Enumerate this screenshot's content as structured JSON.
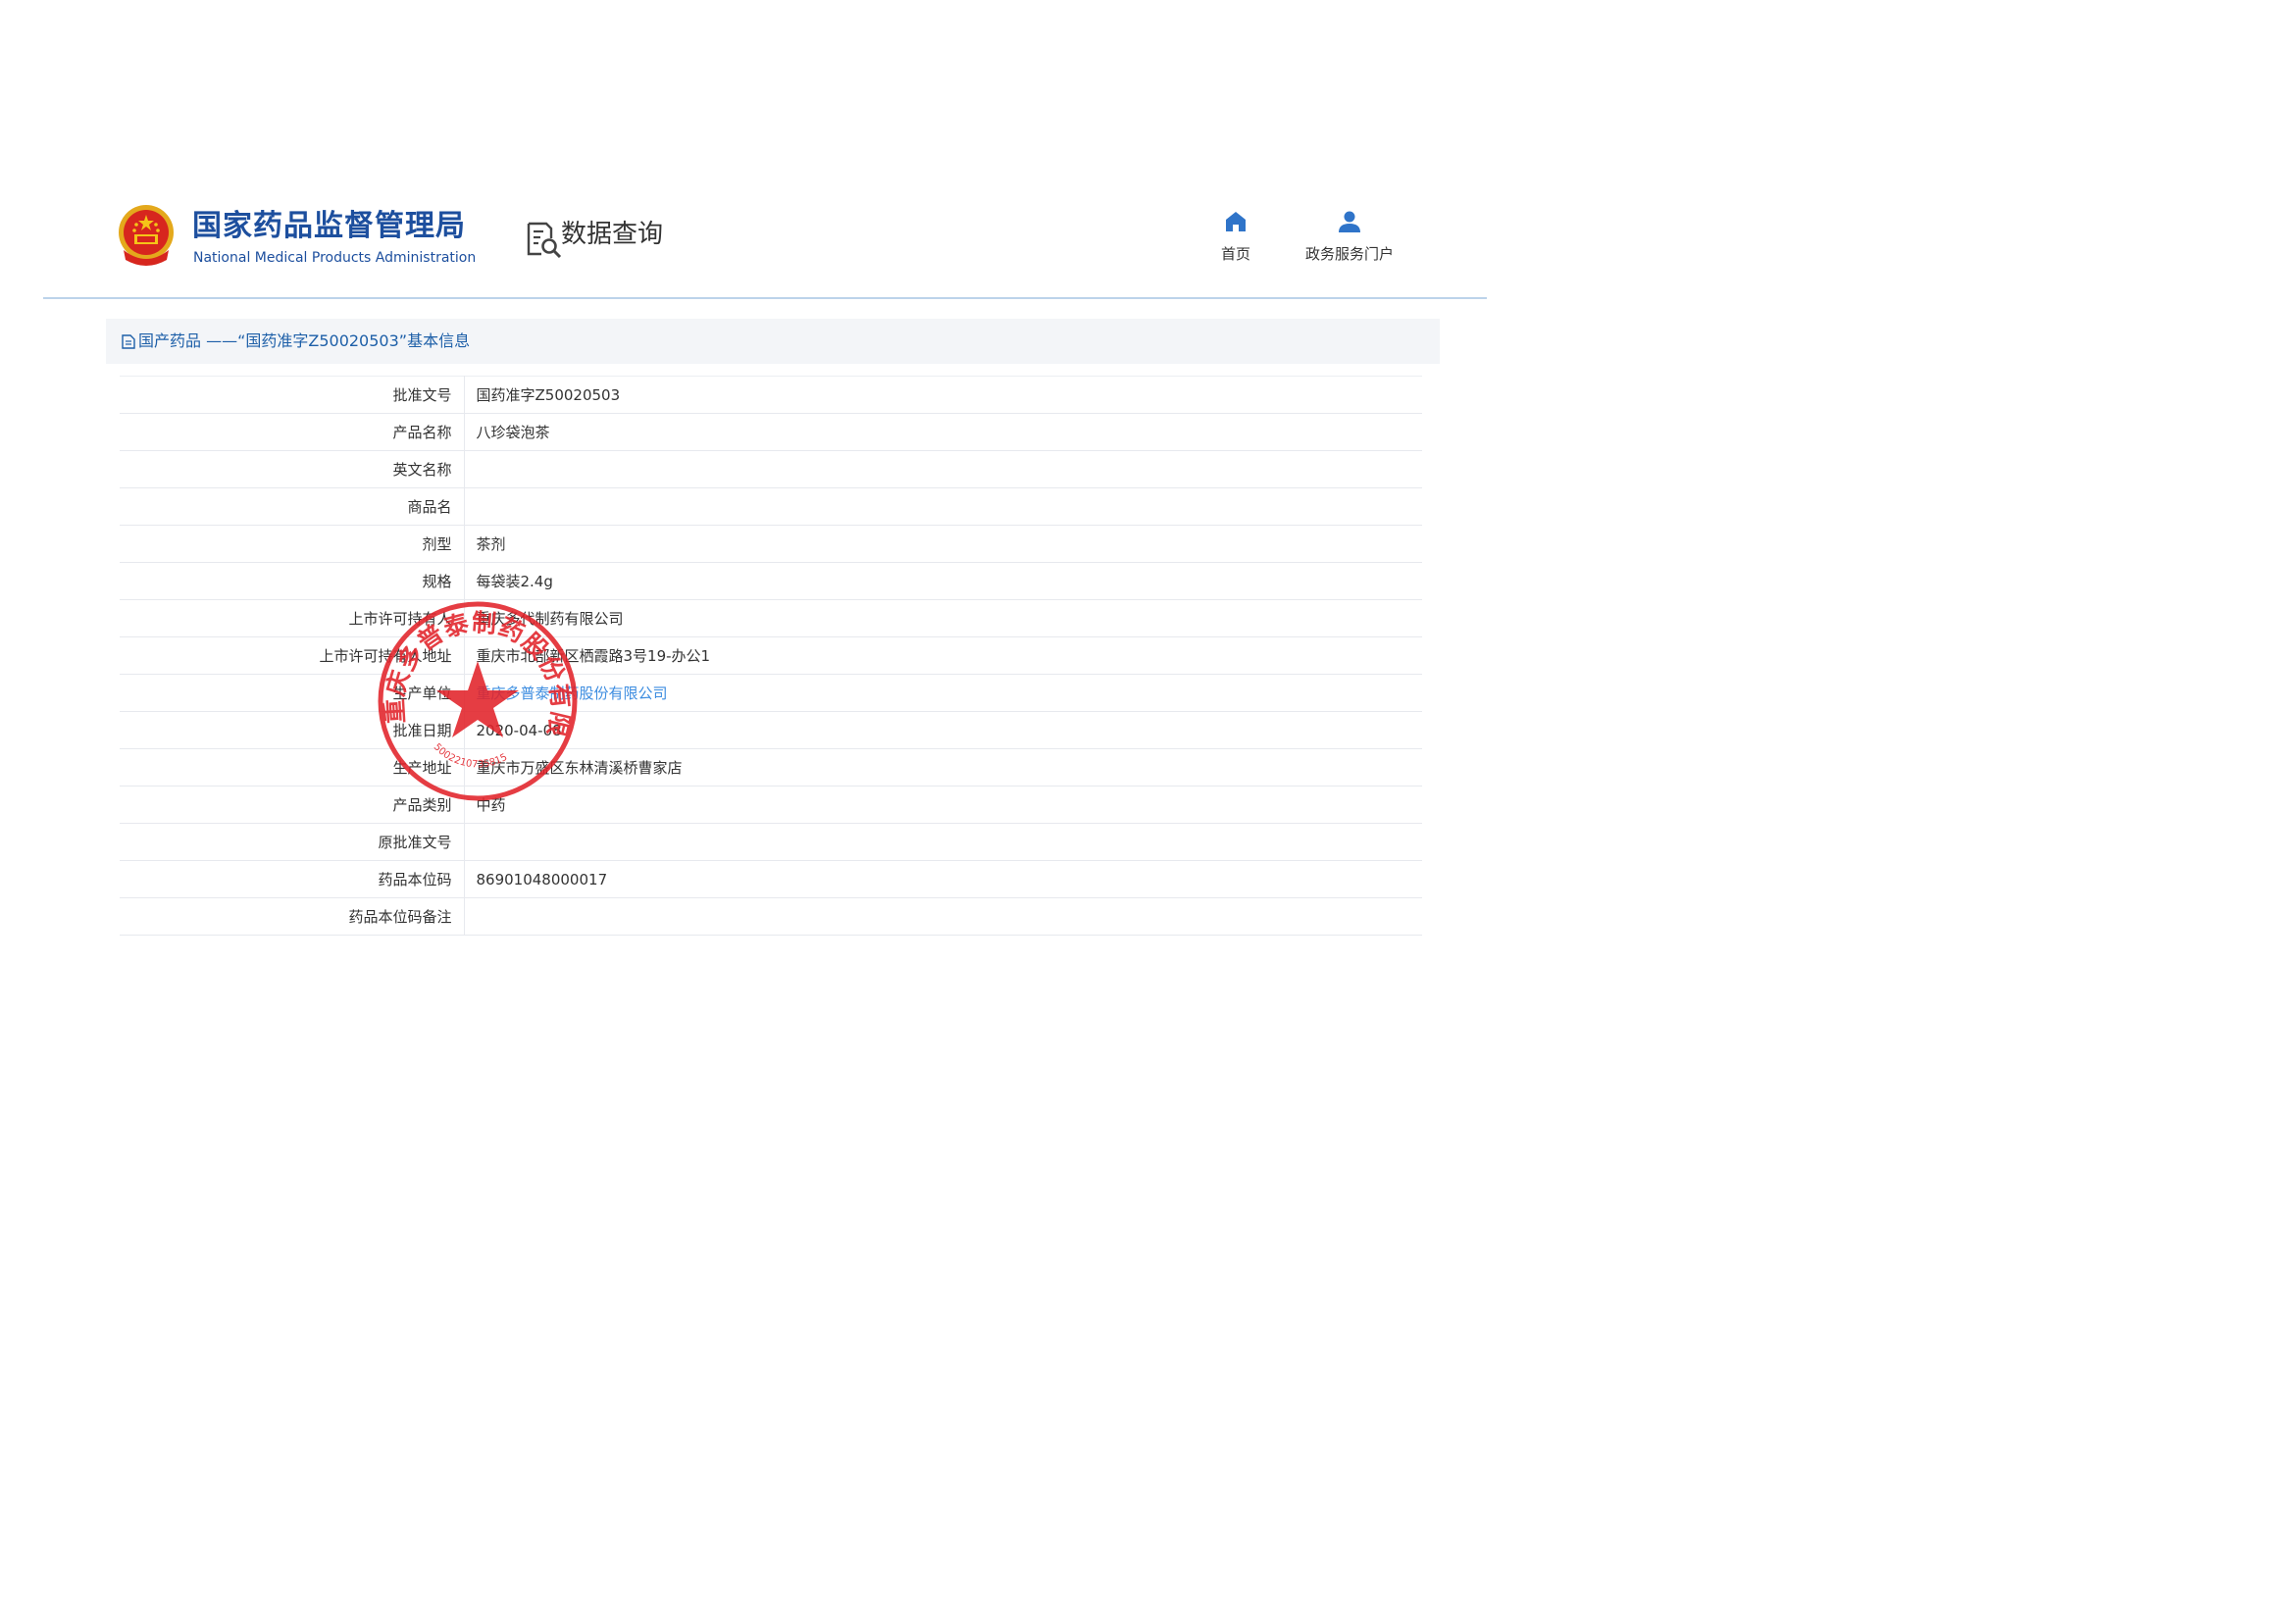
{
  "header": {
    "agency_name_cn": "国家药品监督管理局",
    "agency_name_en": "National Medical Products Administration",
    "data_query_label": "数据查询",
    "nav": {
      "home_label": "首页",
      "portal_label": "政务服务门户"
    }
  },
  "section": {
    "title": "国产药品 ——“国药准字Z50020503”基本信息"
  },
  "rows": [
    {
      "label": "批准文号",
      "value": "国药准字Z50020503"
    },
    {
      "label": "产品名称",
      "value": "八珍袋泡茶"
    },
    {
      "label": "英文名称",
      "value": ""
    },
    {
      "label": "商品名",
      "value": ""
    },
    {
      "label": "剂型",
      "value": "茶剂"
    },
    {
      "label": "规格",
      "value": "每袋装2.4g"
    },
    {
      "label": "上市许可持有人",
      "value": "重庆多代制药有限公司"
    },
    {
      "label": "上市许可持有人地址",
      "value": "重庆市北部新区栖霞路3号19-办公1"
    },
    {
      "label": "生产单位",
      "value": "重庆多普泰制药股份有限公司",
      "link": true
    },
    {
      "label": "批准日期",
      "value": "2020-04-08"
    },
    {
      "label": "生产地址",
      "value": "重庆市万盛区东林清溪桥曹家店"
    },
    {
      "label": "产品类别",
      "value": "中药"
    },
    {
      "label": "原批准文号",
      "value": ""
    },
    {
      "label": "药品本位码",
      "value": "86901048000017"
    },
    {
      "label": "药品本位码备注",
      "value": ""
    }
  ],
  "seal": {
    "text": "重庆多普泰制药股份有限公司",
    "number": "5002210735815"
  },
  "colors": {
    "brand_blue": "#1d4f9e",
    "link_blue": "#3d8de0",
    "seal_red": "#e2232a",
    "divider": "#bcd3ea"
  },
  "icons": [
    "national-emblem",
    "data-search-icon",
    "home-icon",
    "user-icon",
    "document-icon",
    "seal-star"
  ]
}
